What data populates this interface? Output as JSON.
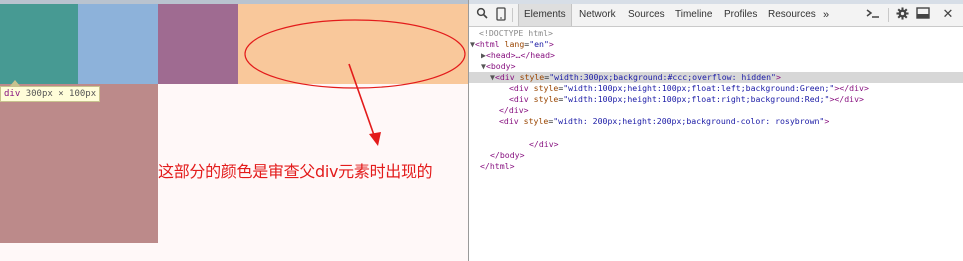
{
  "annotation": {
    "text": "这部分的颜色是审查父div元素时出现的"
  },
  "tooltip": {
    "tag": "div",
    "dims": "300px × 100px"
  },
  "devtools": {
    "tabs": [
      {
        "label": "Elements",
        "active": true
      },
      {
        "label": "Network",
        "active": false
      },
      {
        "label": "Sources",
        "active": false
      },
      {
        "label": "Timeline",
        "active": false
      },
      {
        "label": "Profiles",
        "active": false
      },
      {
        "label": "Resources",
        "active": false
      }
    ],
    "more_label": "»",
    "icons": [
      "search-icon",
      "device-mode-icon",
      "console-drawer-icon",
      "settings-gear-icon",
      "dock-side-icon",
      "close-icon"
    ],
    "dom": {
      "doctype": "<!DOCTYPE html>",
      "html_open": "<html",
      "html_attr_name": "lang",
      "html_attr_value": "\"en\"",
      "gt": ">",
      "head": "<head>…</head>",
      "body_open": "<body>",
      "div_open": "<div",
      "style_attr": "style",
      "div1_style": "\"width:300px;background:#ccc;overflow: hidden\"",
      "div2_style": "\"width:100px;height:100px;float:left;background:Green;\"",
      "div3_style": "\"width:100px;height:100px;float:right;background:Red;\"",
      "div4_style": "\"width: 200px;height:200px;background-color: rosybrown\"",
      "div_close": "</div>",
      "div_close_inline": "></div>",
      "body_close": "</body>",
      "html_close": "</html>"
    }
  },
  "colors": {
    "highlight_teal": "#479a93",
    "highlight_blue": "#8db2da",
    "highlight_purple": "#9f6b91",
    "highlight_peach": "#f9c89b",
    "rosybrown": "#bc8a8a",
    "annotation_red": "#e31b1b"
  }
}
